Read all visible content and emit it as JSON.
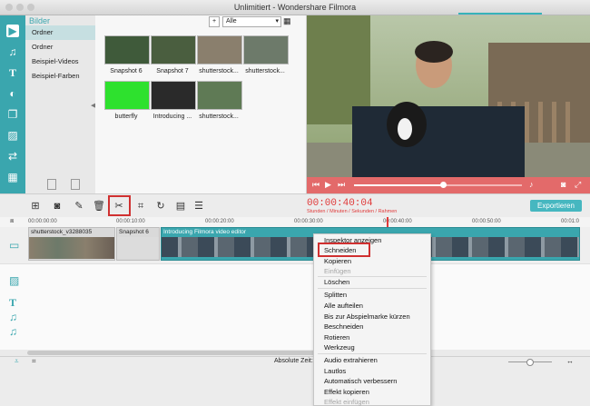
{
  "window": {
    "title": "Unlimitiert - Wondershare Filmora"
  },
  "library": {
    "header": "Bilder",
    "items": [
      {
        "label": "Ordner"
      },
      {
        "label": "Ordner"
      },
      {
        "label": "Beispiel-Videos"
      },
      {
        "label": "Beispiel-Farben"
      }
    ]
  },
  "media": {
    "filter_value": "Alle",
    "thumbnails": [
      {
        "caption": "Snapshot 6",
        "color": "#3f5a3a"
      },
      {
        "caption": "Snapshot 7",
        "color": "#4a5e3f"
      },
      {
        "caption": "shutterstock...",
        "color": "#8a7f6d"
      },
      {
        "caption": "shutterstock...",
        "color": "#6d7a6a"
      },
      {
        "caption": "butterfly",
        "color": "#2ee12e"
      },
      {
        "caption": "Introducing ...",
        "color": "#2a2a2a"
      },
      {
        "caption": "shutterstock...",
        "color": "#5f7a55"
      }
    ]
  },
  "timecode": {
    "value": "00:00:40:04",
    "sub": "Stunden / Minuten / Sekunden / Rahmen"
  },
  "toolbar": {
    "export_label": "Exportieren"
  },
  "ruler": {
    "ticks": [
      "00:00:00:00",
      "00:00:10:00",
      "00:00:20:00",
      "00:00:30:00",
      "00:00:40:00",
      "00:00:50:00",
      "00:01:0"
    ]
  },
  "timeline": {
    "clips": [
      {
        "label": "shutterstock_v3288035"
      },
      {
        "label": "Snapshot 6"
      },
      {
        "label": "Introducing Filmora video editor"
      }
    ],
    "status_label": "Absolute Zeit:0"
  },
  "context_menu": {
    "items": [
      {
        "label": "Inspektor anzeigen",
        "disabled": false
      },
      {
        "label": "Schneiden",
        "disabled": false
      },
      {
        "label": "Kopieren",
        "disabled": false
      },
      {
        "label": "Einfügen",
        "disabled": true
      },
      {
        "label": "Löschen",
        "disabled": false
      },
      {
        "label": "Splitten",
        "disabled": false
      },
      {
        "label": "Alle aufteilen",
        "disabled": false
      },
      {
        "label": "Bis zur Abspielmarke kürzen",
        "disabled": false
      },
      {
        "label": "Beschneiden",
        "disabled": false
      },
      {
        "label": "Rotieren",
        "disabled": false
      },
      {
        "label": "Werkzeug",
        "disabled": false
      },
      {
        "label": "Audio extrahieren",
        "disabled": false
      },
      {
        "label": "Lautlos",
        "disabled": false
      },
      {
        "label": "Automatisch verbessern",
        "disabled": false
      },
      {
        "label": "Effekt kopieren",
        "disabled": false
      },
      {
        "label": "Effekt einfügen",
        "disabled": true
      }
    ]
  },
  "colors": {
    "accent": "#3aa6ae",
    "timecode": "#e03a3a",
    "preview_controls": "#e36a6a",
    "highlight_box": "#d03030"
  }
}
